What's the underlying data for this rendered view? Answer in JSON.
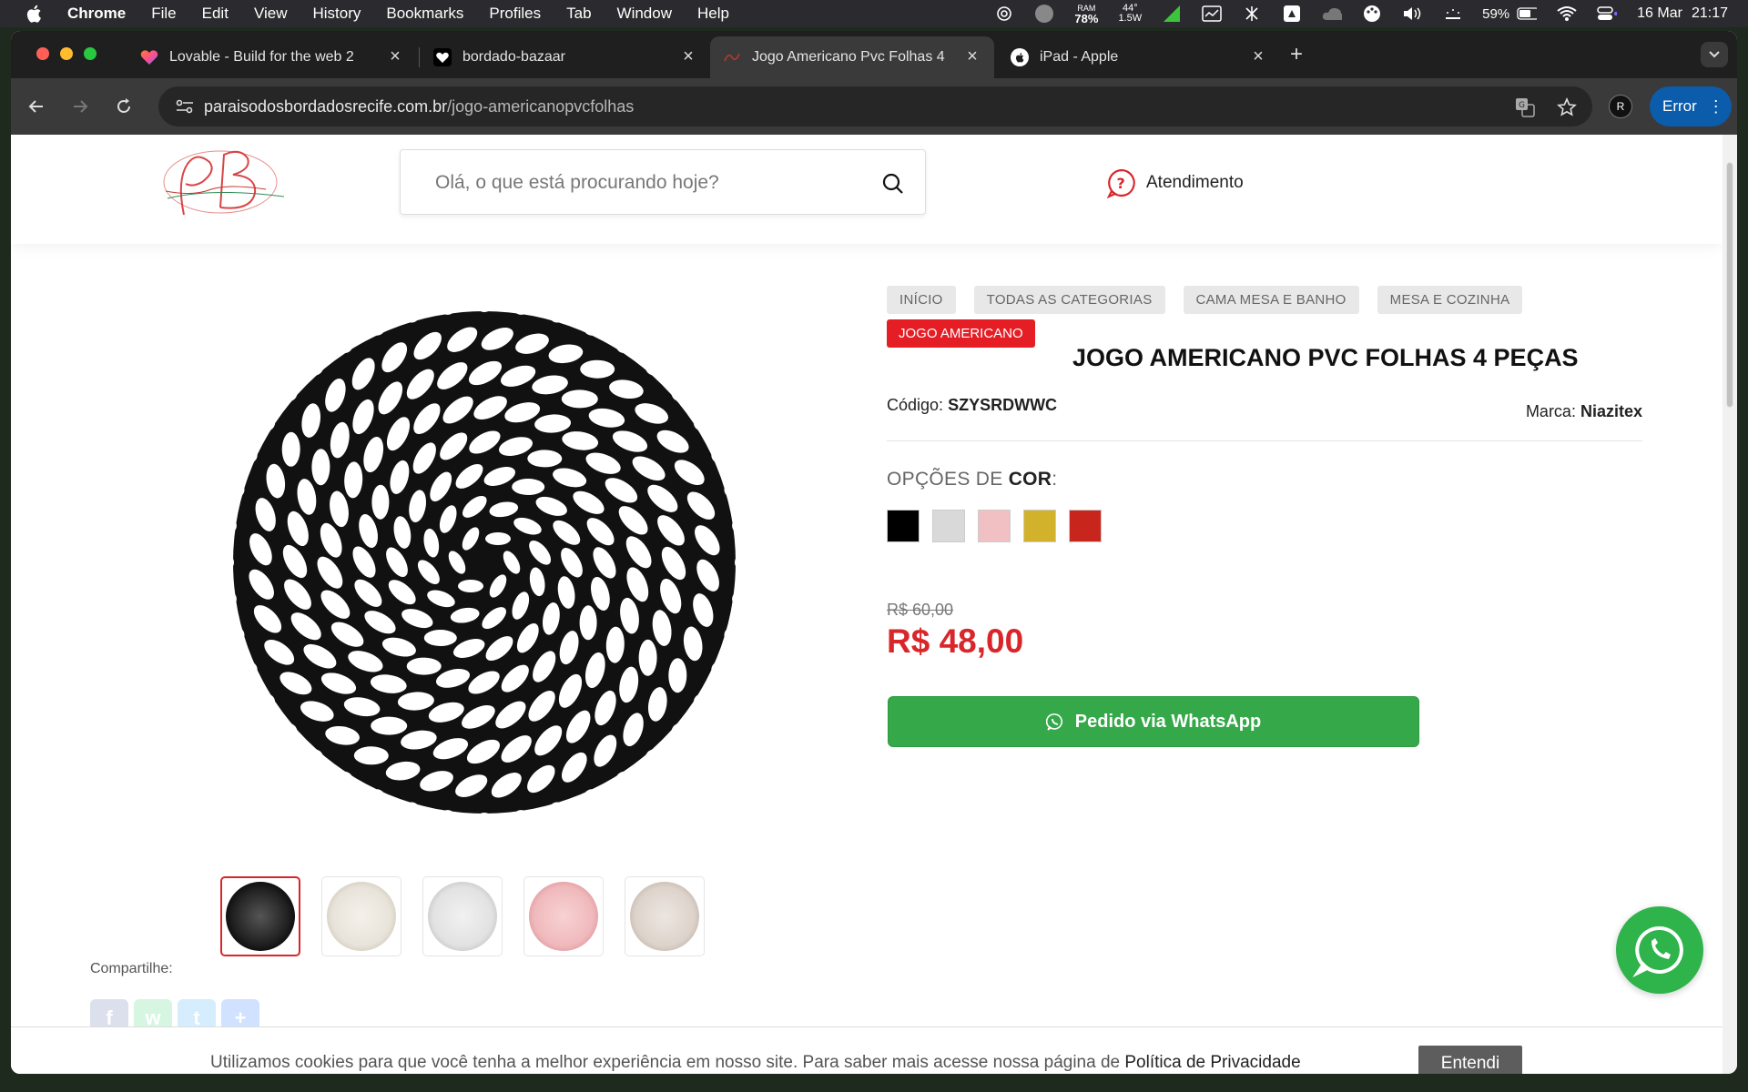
{
  "menubar": {
    "app": "Chrome",
    "items": [
      "File",
      "Edit",
      "View",
      "History",
      "Bookmarks",
      "Profiles",
      "Tab",
      "Window",
      "Help"
    ],
    "ram_label": "RAM",
    "ram_value": "78%",
    "temp_label": "44°",
    "power_label": "1.5W",
    "battery": "59%",
    "date": "16 Mar",
    "time": "21:17"
  },
  "tabs": [
    {
      "title": "Lovable - Build for the web 2",
      "icon": "lovable-heart-icon"
    },
    {
      "title": "bordado-bazaar",
      "icon": "heart-icon"
    },
    {
      "title": "Jogo Americano Pvc Folhas 4",
      "icon": "site-logo-icon"
    },
    {
      "title": "iPad - Apple",
      "icon": "apple-icon"
    }
  ],
  "omnibox": {
    "domain": "paraisodosbordadosrecife.com.br",
    "path": "/jogo-americanopvcfolhas"
  },
  "error_button": "Error",
  "profile_initial": "R",
  "site": {
    "search_placeholder": "Olá, o que está procurando hoje?",
    "support_label": "Atendimento"
  },
  "breadcrumbs": [
    "INÍCIO",
    "TODAS AS CATEGORIAS",
    "CAMA MESA E BANHO",
    "MESA E COZINHA"
  ],
  "category_active": "JOGO AMERICANO",
  "product": {
    "title": "JOGO AMERICANO PVC FOLHAS 4 PEÇAS",
    "code_label": "Código:",
    "code": "SZYSRDWWC",
    "brand_label": "Marca:",
    "brand": "Niazitex",
    "options_prefix": "OPÇÕES DE ",
    "options_strong": "COR",
    "options_suffix": ":",
    "colors": [
      "#000000",
      "#d9d9d9",
      "#f0c0c2",
      "#d2b22a",
      "#c8261c"
    ],
    "old_price": "R$ 60,00",
    "price": "R$ 48,00",
    "order_button": "Pedido via WhatsApp",
    "thumb_colors": [
      "#2d2d2d",
      "#e8e3da",
      "#e2e2e2",
      "#f0b9bc",
      "#ddd3cb"
    ]
  },
  "share_label": "Compartilhe:",
  "cookie": {
    "text": "Utilizamos cookies para que você tenha a melhor experiência em nosso site. Para saber mais acesse nossa página de ",
    "link": "Política de Privacidade",
    "button": "Entendi"
  }
}
